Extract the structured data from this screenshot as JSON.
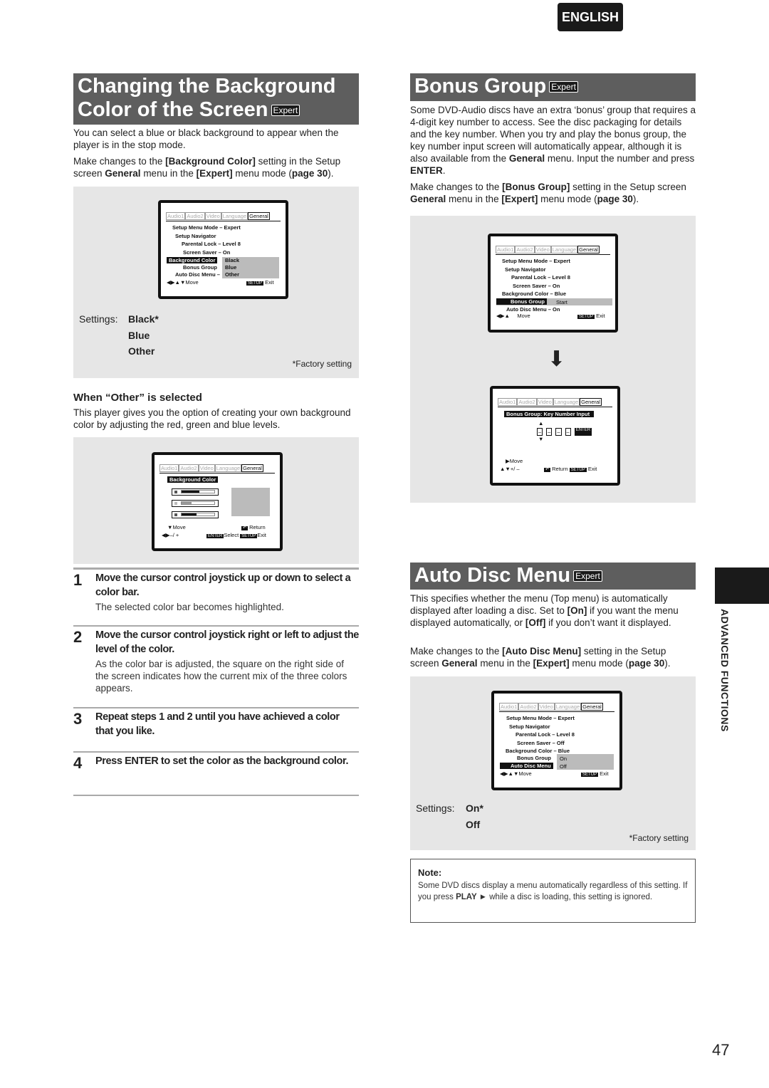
{
  "badge": "ENGLISH",
  "left": {
    "title_line1": "Changing the Background",
    "title_line2": "Color of the Screen",
    "expert": "Expert",
    "intro": "You can select a blue or black background to appear when the player is in the stop mode.",
    "make_pre": "Make changes to the ",
    "make_setting": "[Background Color]",
    "make_mid": " setting in the Setup screen ",
    "make_menu": "General",
    "make_mid2": " menu in the ",
    "make_mode": "[Expert]",
    "make_post": " menu mode (",
    "make_page": "page 30",
    "make_end": ").",
    "osd": {
      "tabs": [
        "Audio1",
        "Audio2",
        "Video",
        "Language",
        "General"
      ],
      "l1": "Setup Menu Mode – Expert",
      "l2": "Setup Navigator",
      "l3": "Parental Lock – Level 8",
      "l4": "Screen Saver – On",
      "l5": "Background Color",
      "l6": "Bonus Group",
      "l7": "Auto Disc Menu –",
      "o1": "Black",
      "o2": "Blue",
      "o3": "Other",
      "move": "Move",
      "setup": "SETUP",
      "exit": "Exit"
    },
    "settings_label": "Settings:",
    "settings": [
      "Black*",
      "Blue",
      "Other"
    ],
    "factory": "*Factory setting",
    "other_heading": "When “Other” is selected",
    "other_text": "This player gives you the option of creating your own background color by adjusting the red, green and blue levels.",
    "osd2": {
      "title": "Background Color",
      "move": "Move",
      "adjust": "–/ +",
      "return": "Return",
      "enter": "ENTER",
      "select": "Select",
      "setup": "SETUP",
      "exit": "Exit",
      "levels": [
        0.55,
        0.3,
        0.45
      ]
    },
    "steps": [
      {
        "num": "1",
        "heading": "Move the cursor control joystick up or down to select a color bar.",
        "text": "The selected color bar becomes highlighted."
      },
      {
        "num": "2",
        "heading": "Move the cursor control joystick right or left to adjust the level of the color.",
        "text": "As the color bar is adjusted, the square on the right side of the screen indicates how the current mix of the three colors appears."
      },
      {
        "num": "3",
        "heading": "Repeat steps 1 and 2 until you have achieved a color that you like.",
        "text": ""
      },
      {
        "num": "4",
        "heading": "Press ENTER to set the color as the background color.",
        "text": ""
      }
    ]
  },
  "bonus": {
    "title": "Bonus Group",
    "expert": "Expert",
    "intro_a": "Some DVD-Audio discs have an extra ‘bonus’ group that requires a 4-digit key number to access. See the disc packaging for details and the key number. When you try and play the bonus group, the key number input screen will automatically appear, although it is also available from the ",
    "intro_b": "General",
    "intro_c": " menu. Input the number and press ",
    "intro_d": "ENTER",
    "intro_e": ".",
    "make_pre": "Make changes to the ",
    "make_setting": "[Bonus Group]",
    "make_mid": " setting in the Setup screen ",
    "make_menu": "General",
    "make_mid2": " menu in the ",
    "make_mode": "[Expert]",
    "make_post": " menu mode (",
    "make_page": "page 30",
    "make_end": ").",
    "osd": {
      "l1": "Setup Menu Mode – Expert",
      "l2": "Setup Navigator",
      "l3": "Parental Lock – Level 8",
      "l4": "Screen Saver – On",
      "l5": "Background Color – Blue",
      "l6": "Bonus Group",
      "l6v": "Start",
      "l7": "Auto Disc Menu – On",
      "move": "Move",
      "setup": "SETUP",
      "exit": "Exit"
    },
    "osd2": {
      "title": "Bonus Group: Key Number Input",
      "digits": [
        "–",
        "–",
        "–",
        "–"
      ],
      "enter": "ENTER",
      "move": "Move",
      "adjust": "+/ –",
      "return": "Return",
      "setup": "SETUP",
      "exit": "Exit"
    }
  },
  "auto": {
    "title": "Auto Disc Menu",
    "expert": "Expert",
    "intro_a": "This specifies whether the menu (Top menu) is automatically displayed after loading a disc. Set to ",
    "on": "[On]",
    "intro_b": " if you want the menu displayed automatically, or ",
    "off": "[Off]",
    "intro_c": " if you don’t want it displayed.",
    "make_pre": "Make changes to the ",
    "make_setting": "[Auto Disc Menu]",
    "make_mid": " setting in the Setup screen ",
    "make_menu": "General",
    "make_mid2": " menu in the ",
    "make_mode": "[Expert]",
    "make_post": " menu mode (",
    "make_page": "page 30",
    "make_end": ").",
    "osd": {
      "l1": "Setup Menu Mode – Expert",
      "l2": "Setup Navigator",
      "l3": "Parental Lock – Level 8",
      "l4": "Screen Saver – Off",
      "l5": "Background Color – Blue",
      "l6": "Bonus Group",
      "l7": "Auto Disc Menu",
      "o1": "On",
      "o2": "Off",
      "move": "Move",
      "setup": "SETUP",
      "exit": "Exit"
    },
    "settings_label": "Settings:",
    "settings": [
      "On*",
      "Off"
    ],
    "factory": "*Factory setting",
    "note_title": "Note:",
    "note_a": "Some DVD discs display a menu automatically regardless of this setting. If you press ",
    "note_play": "PLAY ►",
    "note_b": " while a disc is loading, this setting is ignored."
  },
  "side_tab": "ADVANCED FUNCTIONS",
  "page_number": "47"
}
